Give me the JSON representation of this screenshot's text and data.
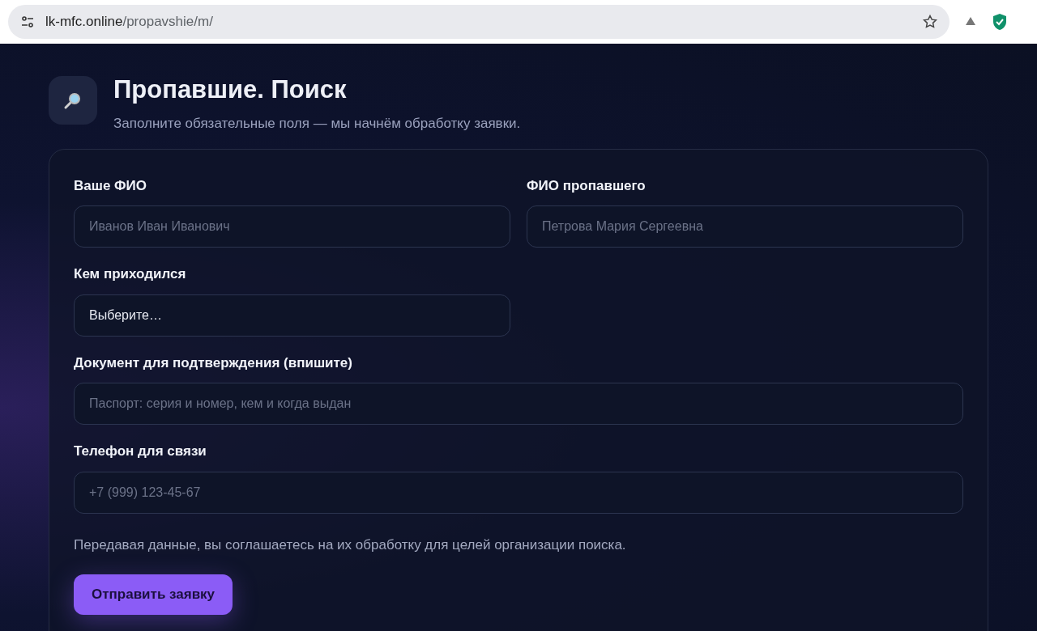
{
  "browser": {
    "host": "lk-mfc.online",
    "path": "/propavshie/m/"
  },
  "header": {
    "title": "Пропавшие. Поиск",
    "subtitle": "Заполните обязательные поля — мы начнём обработку заявки."
  },
  "form": {
    "rows": [
      [
        {
          "kind": "text",
          "label": "Ваше ФИО",
          "placeholder": "Иванов Иван Иванович"
        },
        {
          "kind": "text",
          "label": "ФИО пропавшего",
          "placeholder": "Петрова Мария Сергеевна"
        }
      ],
      [
        {
          "kind": "select",
          "label": "Кем приходился",
          "value": "Выберите…"
        }
      ],
      [
        {
          "kind": "text",
          "label": "Документ для подтверждения (впишите)",
          "placeholder": "Паспорт: серия и номер, кем и когда выдан"
        }
      ],
      [
        {
          "kind": "text",
          "label": "Телефон для связи",
          "placeholder": "+7 (999) 123-45-67"
        }
      ]
    ],
    "consent": "Передавая данные, вы соглашаетесь на их обработку для целей организации поиска.",
    "submit": "Отправить заявку"
  }
}
